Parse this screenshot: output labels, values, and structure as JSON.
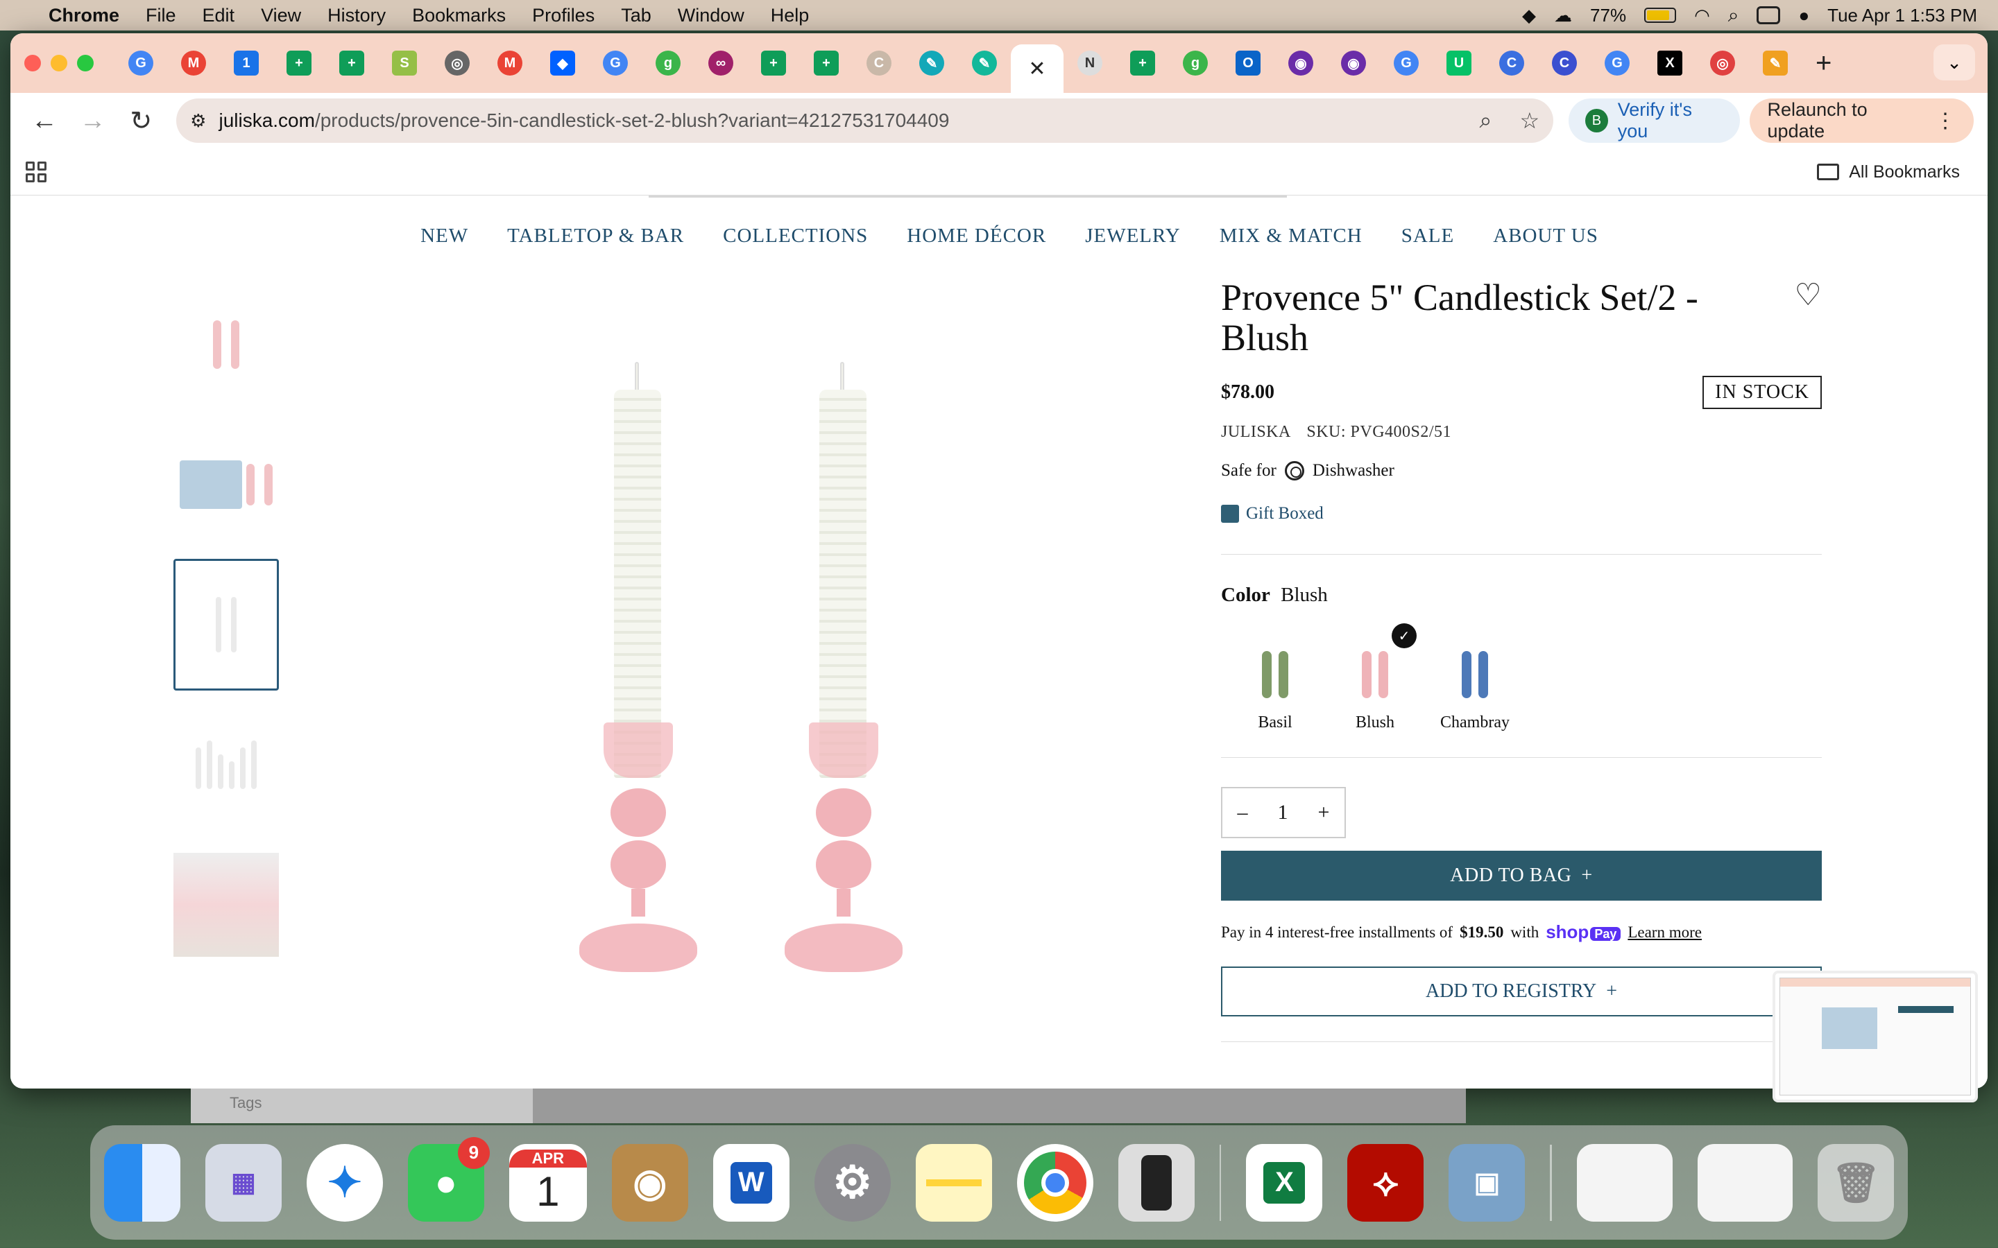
{
  "menubar": {
    "app": "Chrome",
    "items": [
      "File",
      "Edit",
      "View",
      "History",
      "Bookmarks",
      "Profiles",
      "Tab",
      "Window",
      "Help"
    ],
    "battery": "77%",
    "datetime": "Tue Apr 1  1:53 PM"
  },
  "browser": {
    "url_host": "juliska.com",
    "url_path": "/products/provence-5in-candlestick-set-2-blush?variant=42127531704409",
    "verify_label": "Verify it's you",
    "verify_avatar": "B",
    "relaunch_label": "Relaunch to update",
    "all_bookmarks": "All Bookmarks"
  },
  "site_nav": [
    "NEW",
    "TABLETOP & BAR",
    "COLLECTIONS",
    "HOME DÉCOR",
    "JEWELRY",
    "MIX & MATCH",
    "SALE",
    "ABOUT US"
  ],
  "product": {
    "title": "Provence 5\" Candlestick Set/2 - Blush",
    "price": "$78.00",
    "stock": "IN STOCK",
    "brand": "JULISKA",
    "sku": "SKU: PVG400S2/51",
    "safe_for_label": "Safe for",
    "safe_for_value": "Dishwasher",
    "gift": "Gift Boxed",
    "color_label": "Color",
    "color_value": "Blush",
    "colors": [
      {
        "name": "Basil",
        "hex": "#7f9a68"
      },
      {
        "name": "Blush",
        "hex": "#efb3b8"
      },
      {
        "name": "Chambray",
        "hex": "#4d79b8"
      }
    ],
    "quantity": "1",
    "add_to_bag": "ADD TO BAG",
    "installments_pre": "Pay in 4 interest-free installments of",
    "installments_amount": "$19.50",
    "installments_with": "with",
    "shop_label": "shop",
    "pay_label": "Pay",
    "learn_more": "Learn more",
    "add_to_registry": "ADD TO REGISTRY"
  },
  "underlay": {
    "tags_label": "Tags"
  },
  "dock": {
    "messages_badge": "9",
    "calendar_month": "APR",
    "calendar_day": "1"
  },
  "colors": {
    "accent": "#2b5a6b",
    "nav_text": "#1f4c6b",
    "tabstrip": "#f7d5c7"
  }
}
